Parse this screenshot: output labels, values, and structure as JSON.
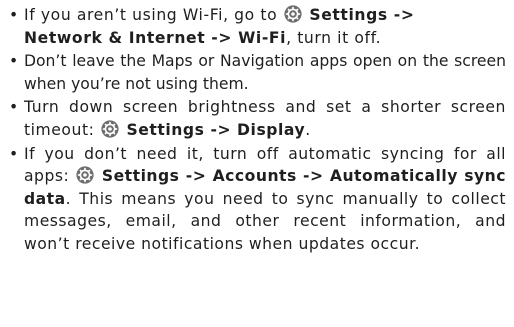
{
  "bullet_char": "•",
  "icon": "settings-gear-icon",
  "colors": {
    "text": "#1f1f1f",
    "icon_fill": "#6d6d6d"
  },
  "items": [
    {
      "t1": "If you aren’t using Wi-Fi, go to ",
      "b1": "Settings ->",
      "b2": "Network & Internet -> Wi-Fi",
      "t2": ", turn it off."
    },
    {
      "t1": "Don’t leave the Maps or Navigation apps open on the screen when you’re not using them."
    },
    {
      "t1": "Turn down screen brightness and set a shorter screen timeout: ",
      "b1": "Settings -> Display",
      "t2": "."
    },
    {
      "t1": "If you don’t need it, turn off automatic syncing for all apps: ",
      "b1": "Settings -> Accounts -> Automatically sync data",
      "t2": ". This means you need to sync manually to collect messages, email, and other recent information, and won’t receive notifications when updates occur."
    }
  ]
}
